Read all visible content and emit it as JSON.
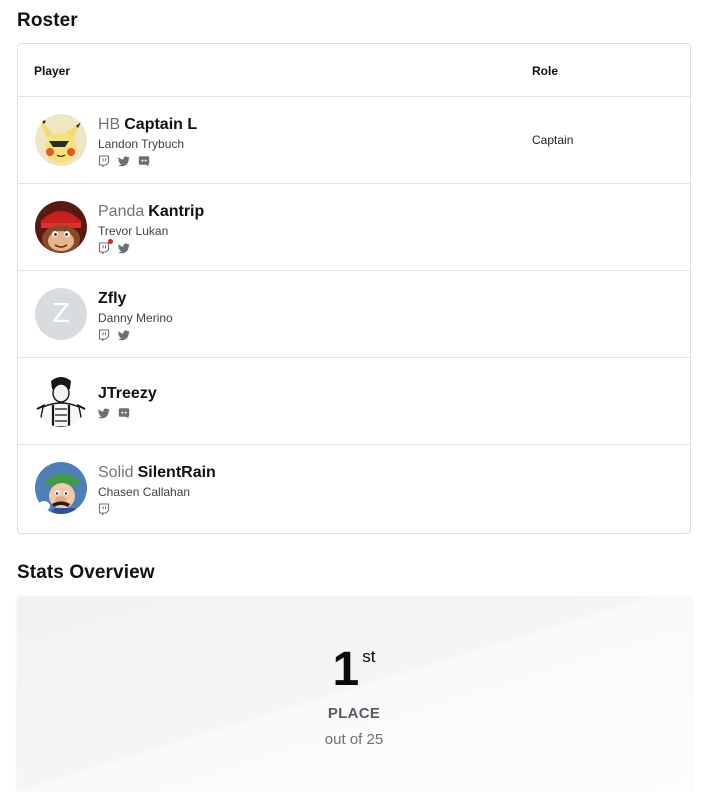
{
  "roster": {
    "title": "Roster",
    "columns": {
      "player": "Player",
      "role": "Role"
    },
    "players": [
      {
        "prefix": "HB",
        "gamertag": "Captain L",
        "real_name": "Landon Trybuch",
        "role": "Captain",
        "socials": [
          "twitch-icon",
          "twitter-icon",
          "discord-icon"
        ],
        "avatar": "pikachu-avatar"
      },
      {
        "prefix": "Panda",
        "gamertag": "Kantrip",
        "real_name": "Trevor Lukan",
        "role": "",
        "socials": [
          "twitch-icon",
          "twitter-icon"
        ],
        "avatar": "diddy-kong-avatar",
        "live": true
      },
      {
        "prefix": "",
        "gamertag": "Zfly",
        "real_name": "Danny Merino",
        "role": "",
        "socials": [
          "twitch-icon",
          "twitter-icon"
        ],
        "avatar": "letter-avatar",
        "initial": "Z"
      },
      {
        "prefix": "",
        "gamertag": "JTreezy",
        "real_name": "",
        "role": "",
        "socials": [
          "twitter-icon",
          "discord-icon"
        ],
        "avatar": "manga-avatar"
      },
      {
        "prefix": "Solid",
        "gamertag": "SilentRain",
        "real_name": "Chasen Callahan",
        "role": "",
        "socials": [
          "twitch-icon"
        ],
        "avatar": "luigi-avatar"
      }
    ]
  },
  "stats": {
    "title": "Stats Overview",
    "place_number": "1",
    "place_suffix": "st",
    "place_label": "PLACE",
    "place_of": "out of 25"
  },
  "colors": {
    "icon": "#6a7077",
    "live_dot": "#d8231f",
    "border": "#dcdfe3"
  }
}
